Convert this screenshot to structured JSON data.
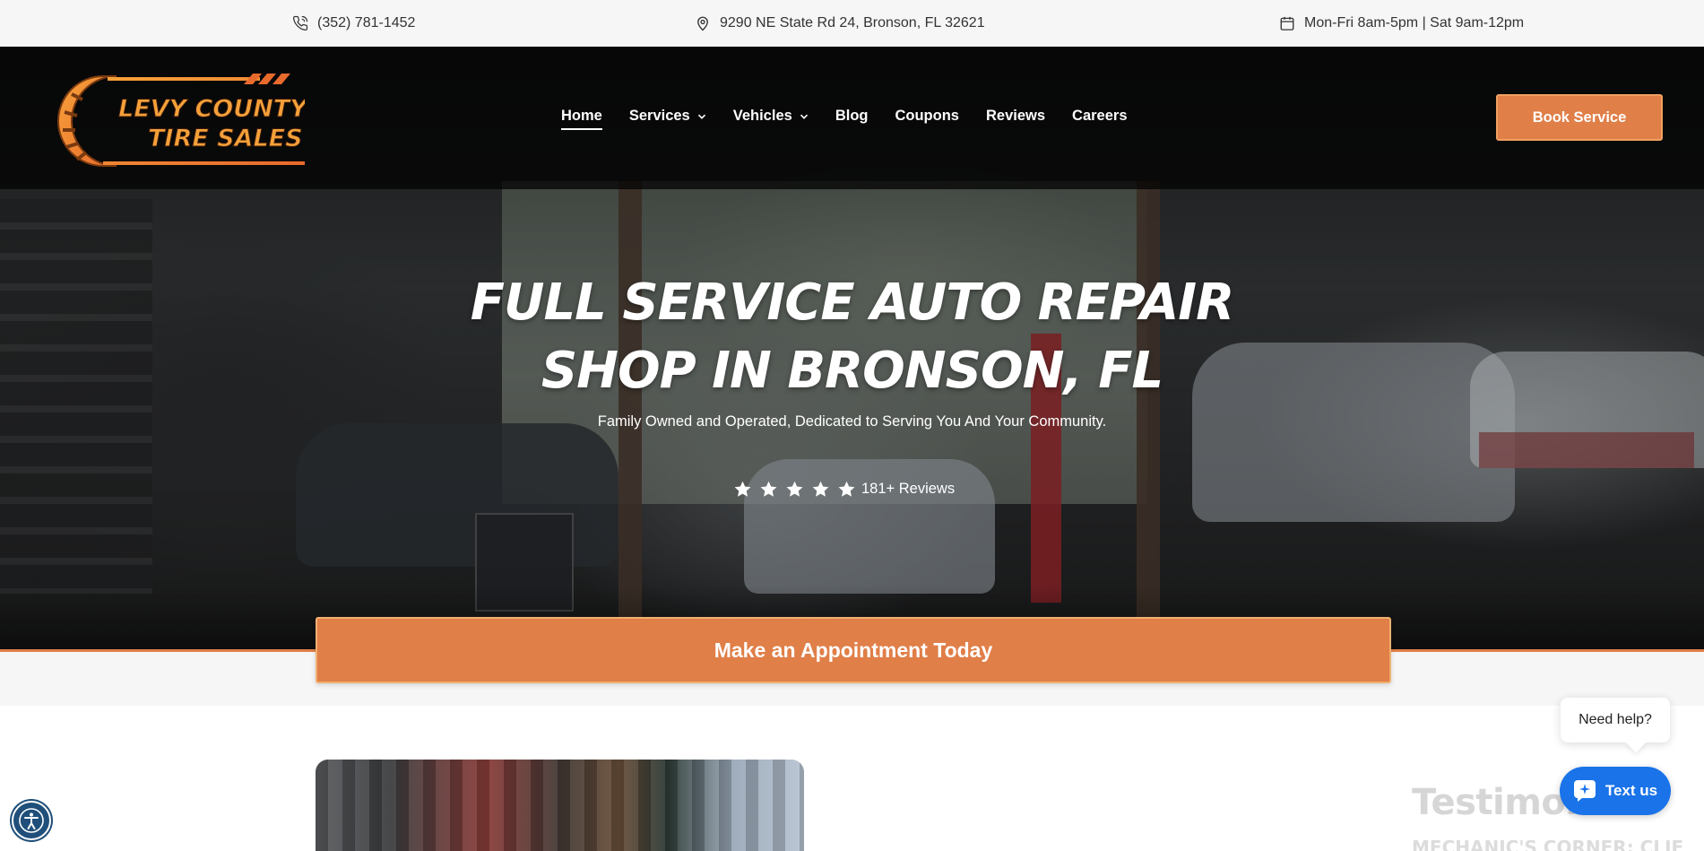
{
  "topbar": {
    "phone": "(352) 781-1452",
    "address": "9290 NE State Rd 24, Bronson, FL 32621",
    "hours": "Mon-Fri 8am-5pm | Sat 9am-12pm"
  },
  "brand": {
    "logo_line1": "LEVY COUNTY",
    "logo_line2": "TIRE SALES",
    "accent_color": "#e07f48"
  },
  "nav": {
    "items": [
      {
        "label": "Home",
        "active": true
      },
      {
        "label": "Services",
        "dropdown": true
      },
      {
        "label": "Vehicles",
        "dropdown": true
      },
      {
        "label": "Blog"
      },
      {
        "label": "Coupons"
      },
      {
        "label": "Reviews"
      },
      {
        "label": "Careers"
      }
    ],
    "cta": "Book Service"
  },
  "hero": {
    "title_line1": "FULL SERVICE AUTO REPAIR",
    "title_line2": "SHOP IN BRONSON, FL",
    "subtitle": "Family Owned and Operated, Dedicated to Serving You And Your Community.",
    "stars": 5,
    "reviews": "181+ Reviews"
  },
  "appointment": {
    "label": "Make an Appointment Today"
  },
  "content": {
    "testimonials_heading": "Testimonials",
    "mechanic_heading": "MECHANIC'S CORNER: CLIE"
  },
  "chat": {
    "prompt": "Need help?",
    "button": "Text us"
  },
  "icons": [
    "phone-icon",
    "location-pin-icon",
    "calendar-icon",
    "chevron-down-icon",
    "star-icon",
    "chat-bubble-icon",
    "accessibility-icon"
  ]
}
